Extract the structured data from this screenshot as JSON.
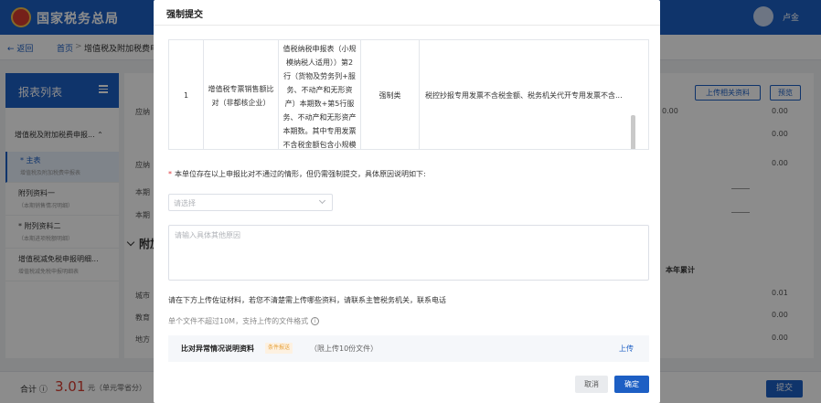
{
  "app": {
    "logo_text": "国家税务总局",
    "user_name": "卢金"
  },
  "breadcrumb": {
    "back": "← 返回",
    "home": "首页",
    "sep": ">",
    "current": "增值税及附加税费申"
  },
  "sidebar": {
    "title": "报表列表",
    "group": "增值税及附加税费申报... ⌃",
    "items": [
      {
        "label": "* 主表",
        "sub": "增值税及附加税费申报表",
        "active": true
      },
      {
        "label": "附列资料一",
        "sub": "（本期销售情况明细）",
        "active": false
      },
      {
        "label": "* 附列资料二",
        "sub": "（本期进项税额明细）",
        "active": false
      },
      {
        "label": "增值税减免税申报明细...",
        "sub": "增值税减免税申报明细表",
        "active": false
      }
    ]
  },
  "main": {
    "buttons": {
      "upload": "上传相关资料",
      "review": "预览"
    },
    "section_title": "附加",
    "year_total_header": "本年累计",
    "values": [
      "0.00",
      "0.00",
      "0.00",
      "0.00",
      "0.01",
      "0.00",
      "0.00",
      "0.00"
    ],
    "labels": {
      "r1": "应纳",
      "r2": "本期",
      "r3": "本期",
      "r4": "城市",
      "r5": "教育",
      "r6": "地方"
    }
  },
  "footer": {
    "total_label": "合计 ⓘ",
    "amount": "3.01",
    "unit": "元（单元零省分）",
    "submit": "提交"
  },
  "modal": {
    "title": "强制提交",
    "table": {
      "row": {
        "index": "1",
        "item": "增值税专票销售额比对（非都核企业）",
        "rule": "值税纳税申报表（小规模纳税人适用））第2行（货物及劳务列+服务、不动产和无形资产）本期数+第5行服务、不动产和无形资产本期数。其中专用发票不含税金额包含小规模",
        "type": "强制类",
        "description": "税控抄报专用发票不含税金额、税务机关代开专用发票不含..."
      }
    },
    "reason_prompt": "本单位存在以上申报比对不通过的情形，但仍需强制提交，具体原因说明如下:",
    "select_placeholder": "请选择",
    "textarea_placeholder": "请输入具体其他原因",
    "upload_hint": "请在下方上传佐证材料，若您不清楚需上传哪些资料，请联系主管税务机关，联系电话",
    "upload_limit": "单个文件不超过10M，支持上传的文件格式",
    "attachment": {
      "name": "比对异常情况说明资料",
      "badge": "条件报送",
      "limit": "（限上传10份文件）",
      "upload": "上传"
    },
    "cancel": "取消",
    "confirm": "确定"
  },
  "colors": {
    "brand": "#1d5fc4",
    "amount_red": "#d63b2f",
    "required_star": "#e0393e",
    "badge_orange": "#e6a23c"
  }
}
